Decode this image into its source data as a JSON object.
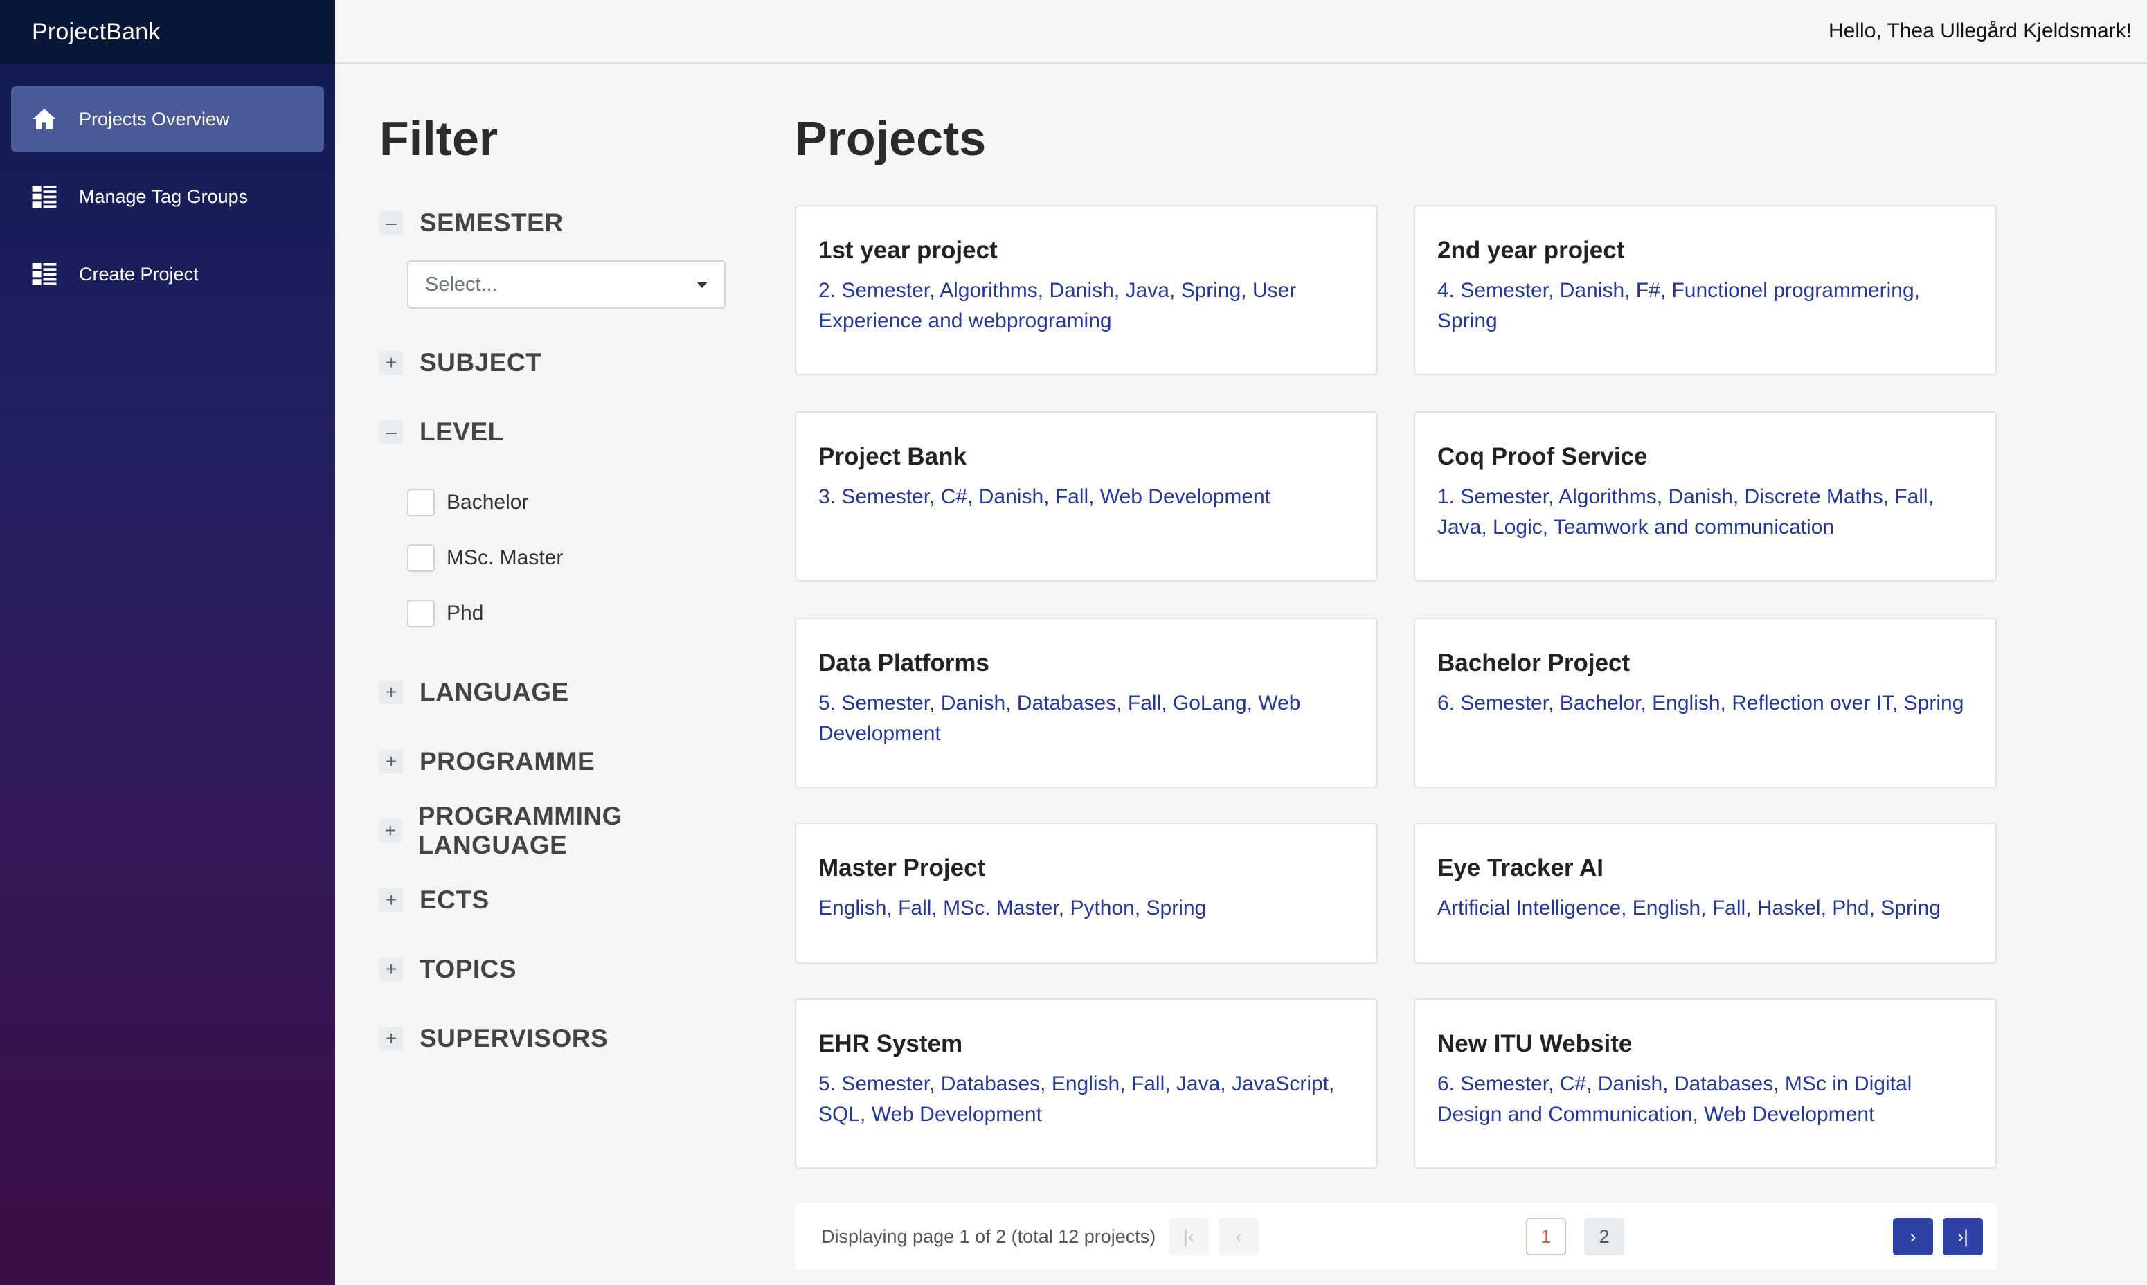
{
  "app": {
    "brand": "ProjectBank",
    "greeting": "Hello, Thea Ullegård Kjeldsmark!"
  },
  "sidebar": {
    "items": [
      {
        "label": "Projects Overview",
        "icon": "home-icon",
        "active": true
      },
      {
        "label": "Manage Tag Groups",
        "icon": "list-icon",
        "active": false
      },
      {
        "label": "Create Project",
        "icon": "list-icon",
        "active": false
      }
    ]
  },
  "filter": {
    "title": "Filter",
    "groups": [
      {
        "name": "SEMESTER",
        "expanded": true,
        "toggle": "–"
      },
      {
        "name": "SUBJECT",
        "expanded": false,
        "toggle": "+"
      },
      {
        "name": "LEVEL",
        "expanded": true,
        "toggle": "–"
      },
      {
        "name": "LANGUAGE",
        "expanded": false,
        "toggle": "+"
      },
      {
        "name": "PROGRAMME",
        "expanded": false,
        "toggle": "+"
      },
      {
        "name": "PROGRAMMING LANGUAGE",
        "expanded": false,
        "toggle": "+"
      },
      {
        "name": "ECTS",
        "expanded": false,
        "toggle": "+"
      },
      {
        "name": "TOPICS",
        "expanded": false,
        "toggle": "+"
      },
      {
        "name": "SUPERVISORS",
        "expanded": false,
        "toggle": "+"
      }
    ],
    "semester_placeholder": "Select...",
    "level_options": [
      "Bachelor",
      "MSc. Master",
      "Phd"
    ]
  },
  "projects": {
    "title": "Projects",
    "cards": [
      {
        "title": "1st year project",
        "tags": "2. Semester, Algorithms, Danish, Java, Spring, User Experience and webprograming"
      },
      {
        "title": "2nd year project",
        "tags": "4. Semester, Danish, F#, Functionel programmering, Spring"
      },
      {
        "title": "Project Bank",
        "tags": "3. Semester, C#, Danish, Fall, Web Development"
      },
      {
        "title": "Coq Proof Service",
        "tags": "1. Semester, Algorithms, Danish, Discrete Maths, Fall, Java, Logic, Teamwork and communication"
      },
      {
        "title": "Data Platforms",
        "tags": "5. Semester, Danish, Databases, Fall, GoLang, Web Development"
      },
      {
        "title": "Bachelor Project",
        "tags": "6. Semester, Bachelor, English, Reflection over IT, Spring"
      },
      {
        "title": "Master Project",
        "tags": "English, Fall, MSc. Master, Python, Spring"
      },
      {
        "title": "Eye Tracker AI",
        "tags": "Artificial Intelligence, English, Fall, Haskel, Phd, Spring"
      },
      {
        "title": "EHR System",
        "tags": "5. Semester, Databases, English, Fall, Java, JavaScript, SQL, Web Development"
      },
      {
        "title": "New ITU Website",
        "tags": "6. Semester, C#, Danish, Databases, MSc in Digital Design and Communication, Web Development"
      }
    ]
  },
  "pagination": {
    "text": "Displaying page 1 of 2 (total 12 projects)",
    "pages": [
      "1",
      "2"
    ],
    "first_glyph": "|‹",
    "prev_glyph": "‹",
    "next_glyph": "›",
    "last_glyph": "›|"
  },
  "colors": {
    "accent": "#2e41a7",
    "tag_text": "#24389c",
    "active_nav": "#4b5a98"
  }
}
